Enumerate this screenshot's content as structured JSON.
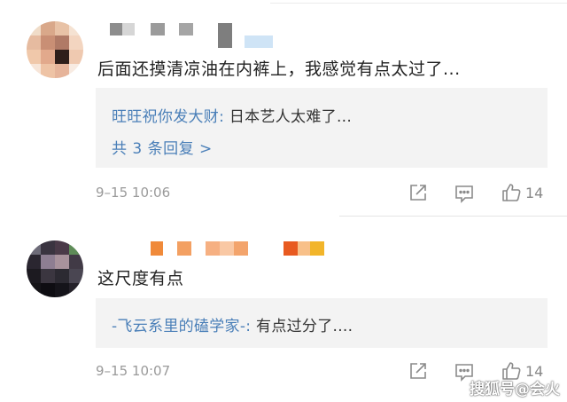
{
  "comments": [
    {
      "text": "后面还摸清凉油在内裤上，我感觉有点太过了...",
      "reply": {
        "author": "旺旺祝你发大财",
        "separator": ": ",
        "body": "日本艺人太难了...",
        "more": "共 3 条回复 >"
      },
      "time": "9–15 10:06",
      "likes": "14"
    },
    {
      "text": "这尺度有点",
      "reply": {
        "author": "-飞云系里的磕学家-",
        "separator": ": ",
        "body": "有点过分了...."
      },
      "time": "9–15 10:07",
      "likes": "14"
    }
  ],
  "icons": [
    "share-icon",
    "comment-icon",
    "like-icon"
  ],
  "colors": {
    "link": "#4a7fb8",
    "reply_bg": "#f3f3f3",
    "meta_text": "#9a9a9a"
  },
  "watermark": "搜狐号@会火"
}
